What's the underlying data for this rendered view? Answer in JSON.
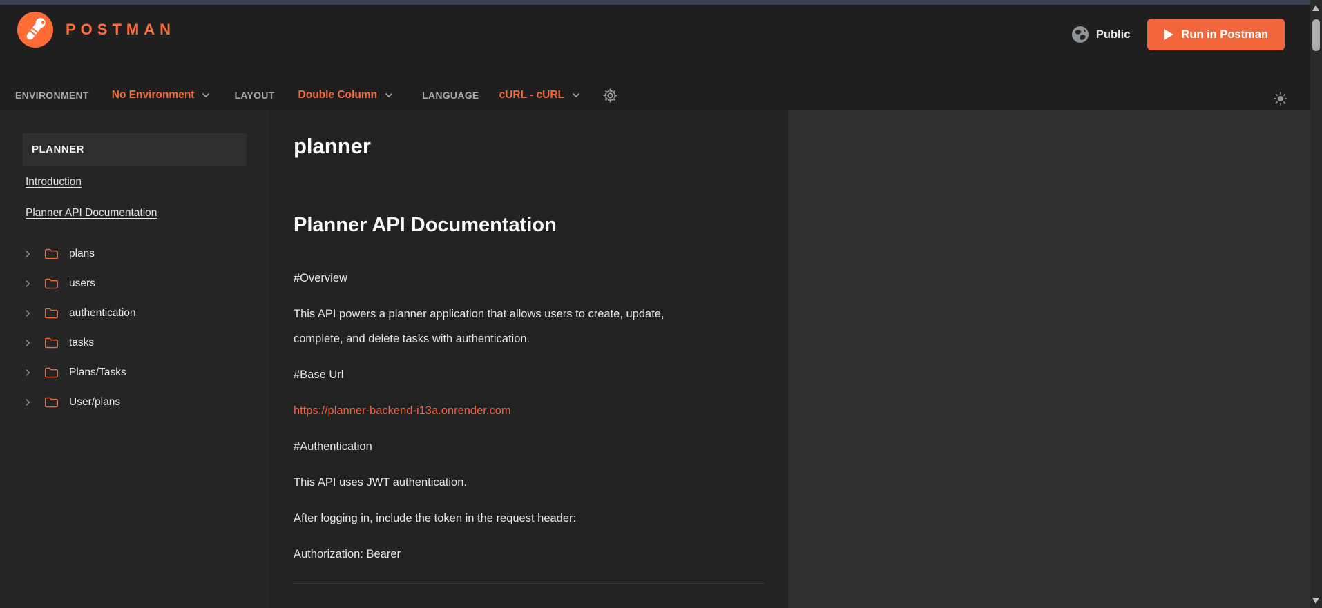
{
  "topbar": {
    "brand": "POSTMAN",
    "visibility_label": "Public",
    "run_button_label": "Run in Postman"
  },
  "toolbar": {
    "environment_label": "ENVIRONMENT",
    "environment_value": "No Environment",
    "layout_label": "LAYOUT",
    "layout_value": "Double Column",
    "language_label": "LANGUAGE",
    "language_value": "cURL - cURL"
  },
  "sidebar": {
    "collection_name": "PLANNER",
    "links": [
      {
        "label": "Introduction"
      },
      {
        "label": "Planner API Documentation"
      }
    ],
    "folders": [
      {
        "label": "plans"
      },
      {
        "label": "users"
      },
      {
        "label": "authentication"
      },
      {
        "label": "tasks"
      },
      {
        "label": "Plans/Tasks"
      },
      {
        "label": "User/plans"
      }
    ]
  },
  "content": {
    "title": "planner",
    "heading": "Planner API Documentation",
    "overview_label": "#Overview",
    "overview_text": "This API powers a planner application that allows users to create, update, complete, and delete tasks with authentication.",
    "base_url_label": "#Base Url",
    "base_url_link": "https://planner-backend-i13a.onrender.com",
    "auth_label": "#Authentication",
    "auth_text": "This API uses JWT authentication.",
    "token_hint_text": "After logging in, include the token in the request header:",
    "authorization_text": "Authorization: Bearer"
  },
  "colors": {
    "brand_orange": "#FF6C37",
    "accent_orange": "#F26B3A",
    "button_orange": "#F2663C",
    "top_strip": "#3A4150",
    "sidebar_bg": "#252526",
    "content_bg": "#222222",
    "right_panel_bg": "#2E2F30"
  }
}
